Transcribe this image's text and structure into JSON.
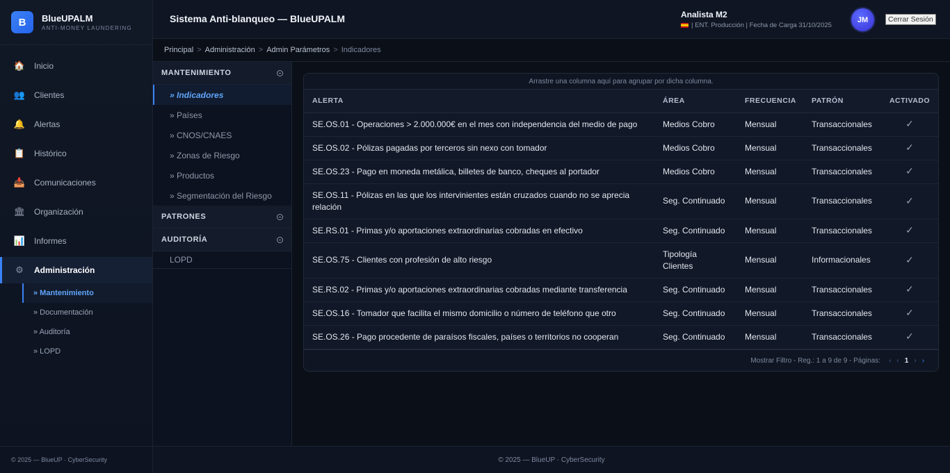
{
  "brand": {
    "logo_letter": "B",
    "name": "BlueUPALM",
    "subtitle": "ANTI-MONEY LAUNDERING",
    "accent": "#3b82f6"
  },
  "sidebar": {
    "items": [
      {
        "label": "Inicio",
        "icon": "home-icon"
      },
      {
        "label": "Clientes",
        "icon": "users-icon"
      },
      {
        "label": "Alertas",
        "icon": "bell-icon"
      },
      {
        "label": "Histórico",
        "icon": "clipboard-icon"
      },
      {
        "label": "Comunicaciones",
        "icon": "inbox-icon"
      },
      {
        "label": "Organización",
        "icon": "bank-icon"
      },
      {
        "label": "Informes",
        "icon": "chart-icon"
      },
      {
        "label": "Administración",
        "icon": "gear-icon",
        "active": true
      }
    ],
    "subitems": [
      {
        "label": "» Mantenimiento",
        "active": true
      },
      {
        "label": "» Documentación"
      },
      {
        "label": "» Auditoría"
      },
      {
        "label": "» LOPD"
      }
    ],
    "footer": "© 2025 — BlueUP · CyberSecurity"
  },
  "header": {
    "title": "Sistema Anti-blanqueo — BlueUPALM",
    "user_name": "Analista M2",
    "user_meta": "| ENT. Producción | Fecha de Carga 31/10/2025",
    "avatar_initials": "JM",
    "logout_label": "Cerrar Sesión"
  },
  "breadcrumb": [
    "Principal",
    "Administración",
    "Admin Parámetros",
    "Indicadores"
  ],
  "panel": {
    "sections": {
      "mantenimiento": "MANTENIMIENTO",
      "patrones": "PATRONES",
      "auditoria": "AUDITORÍA"
    },
    "mantenimiento_items": [
      "» Indicadores",
      "» Países",
      "» CNOS/CNAES",
      "» Zonas de Riesgo",
      "» Productos",
      "» Segmentación del Riesgo"
    ],
    "auditoria_items": [
      "LOPD"
    ]
  },
  "grid": {
    "group_hint": "Arrastre una columna aquí para agrupar por dicha columna.",
    "columns": {
      "alerta": "ALERTA",
      "area": "ÁREA",
      "frecuencia": "FRECUENCIA",
      "patron": "PATRÓN",
      "activado": "ACTIVADO"
    },
    "rows": [
      {
        "alerta": "SE.OS.01 - Operaciones > 2.000.000€ en el mes con independencia del medio de pago",
        "area": "Medios Cobro",
        "frecuencia": "Mensual",
        "patron": "Transaccionales",
        "activado": "✓"
      },
      {
        "alerta": "SE.OS.02 - Pólizas pagadas por terceros sin nexo con tomador",
        "area": "Medios Cobro",
        "frecuencia": "Mensual",
        "patron": "Transaccionales",
        "activado": "✓"
      },
      {
        "alerta": "SE.OS.23 - Pago en moneda metálica, billetes de banco, cheques al portador",
        "area": "Medios Cobro",
        "frecuencia": "Mensual",
        "patron": "Transaccionales",
        "activado": "✓"
      },
      {
        "alerta": "SE.OS.11 - Pólizas en las que los intervinientes están cruzados cuando no se aprecia relación",
        "area": "Seg. Continuado",
        "frecuencia": "Mensual",
        "patron": "Transaccionales",
        "activado": "✓"
      },
      {
        "alerta": "SE.RS.01 - Primas y/o aportaciones extraordinarias cobradas en efectivo",
        "area": "Seg. Continuado",
        "frecuencia": "Mensual",
        "patron": "Transaccionales",
        "activado": "✓"
      },
      {
        "alerta": "SE.OS.75 - Clientes con profesión de alto riesgo",
        "area": "Tipología Clientes",
        "frecuencia": "Mensual",
        "patron": "Informacionales",
        "activado": "✓"
      },
      {
        "alerta": "SE.RS.02 - Primas y/o aportaciones extraordinarias cobradas mediante transferencia",
        "area": "Seg. Continuado",
        "frecuencia": "Mensual",
        "patron": "Transaccionales",
        "activado": "✓"
      },
      {
        "alerta": "SE.OS.16 - Tomador que facilita el mismo domicilio o número de teléfono que otro",
        "area": "Seg. Continuado",
        "frecuencia": "Mensual",
        "patron": "Transaccionales",
        "activado": "✓"
      },
      {
        "alerta": "SE.OS.26 - Pago procedente de paraísos fiscales, países o territorios no cooperan",
        "area": "Seg. Continuado",
        "frecuencia": "Mensual",
        "patron": "Transaccionales",
        "activado": "✓"
      }
    ],
    "footer_text": "Mostrar Filtro - Reg.: 1 a 9 de 9 - Páginas:",
    "pager": {
      "first": "‹",
      "prev": "‹",
      "page": "1",
      "next": "›",
      "last": "›"
    }
  },
  "footer": "© 2025 — BlueUP · CyberSecurity"
}
